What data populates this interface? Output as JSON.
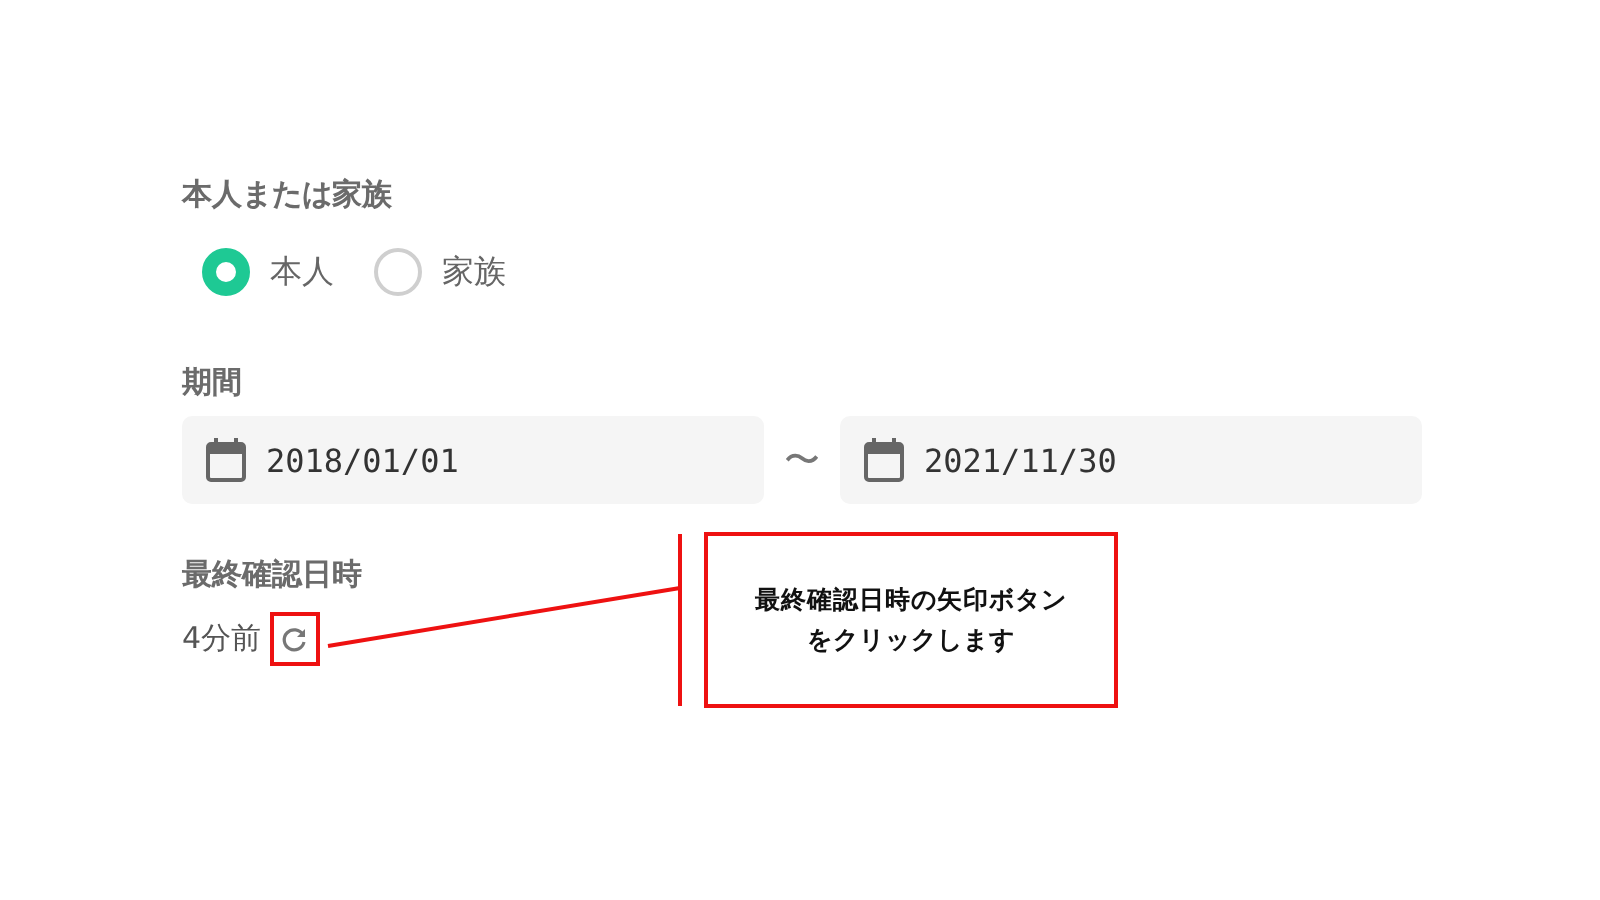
{
  "person_group": {
    "label": "本人または家族",
    "options": [
      {
        "label": "本人",
        "selected": true
      },
      {
        "label": "家族",
        "selected": false
      }
    ]
  },
  "period": {
    "label": "期間",
    "start": "2018/01/01",
    "separator": "〜",
    "end": "2021/11/30"
  },
  "last_checked": {
    "label": "最終確認日時",
    "value": "4分前"
  },
  "annotation": {
    "text": "最終確認日時の矢印ボタンをクリックします"
  }
}
